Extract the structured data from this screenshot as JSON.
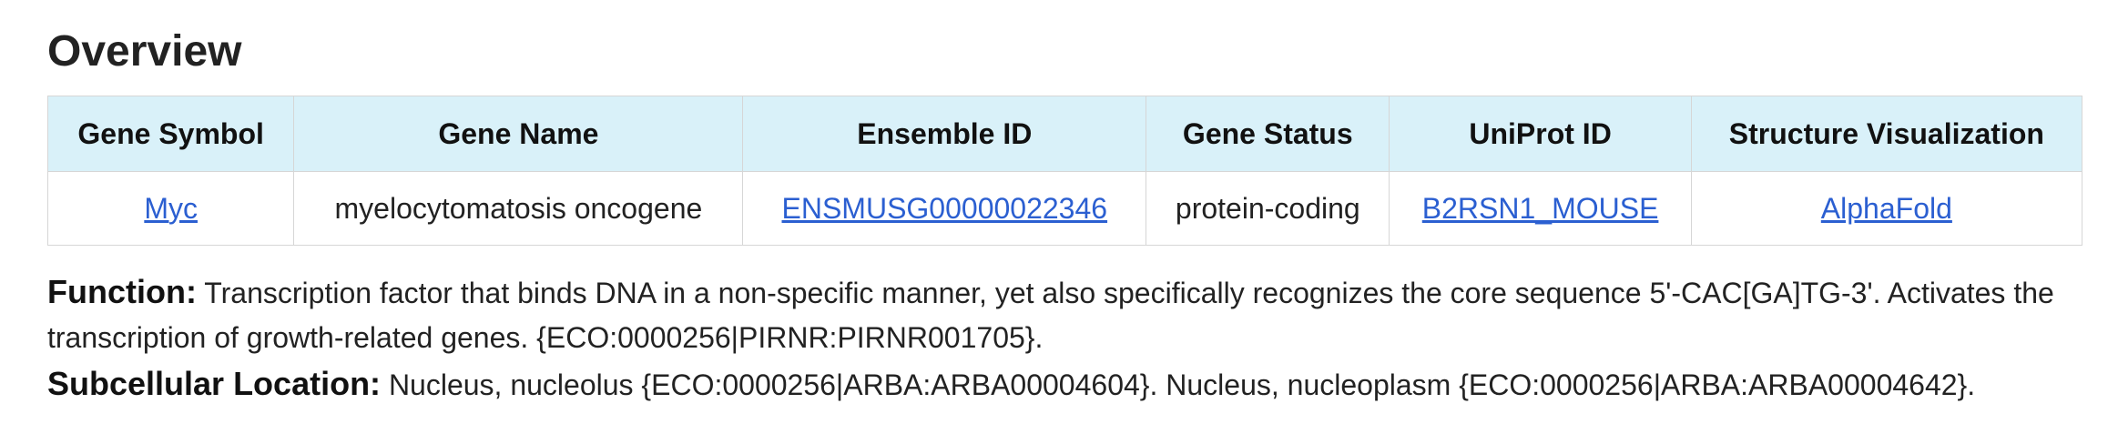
{
  "title": "Overview",
  "table": {
    "headers": [
      "Gene Symbol",
      "Gene Name",
      "Ensemble ID",
      "Gene Status",
      "UniProt ID",
      "Structure Visualization"
    ],
    "row": {
      "gene_symbol": "Myc",
      "gene_name": "myelocytomatosis oncogene",
      "ensemble_id": "ENSMUSG00000022346",
      "gene_status": "protein-coding",
      "uniprot_id": "B2RSN1_MOUSE",
      "structure": "AlphaFold"
    }
  },
  "function": {
    "label": "Function:",
    "text": "Transcription factor that binds DNA in a non-specific manner, yet also specifically recognizes the core sequence 5'-CAC[GA]TG-3'. Activates the transcription of growth-related genes. {ECO:0000256|PIRNR:PIRNR001705}."
  },
  "subcellular": {
    "label": "Subcellular Location:",
    "text": "Nucleus, nucleolus {ECO:0000256|ARBA:ARBA00004604}. Nucleus, nucleoplasm {ECO:0000256|ARBA:ARBA00004642}."
  },
  "colors": {
    "header_bg": "#d9f1f9",
    "link": "#2b5fd1",
    "border": "#d6d6d6"
  }
}
